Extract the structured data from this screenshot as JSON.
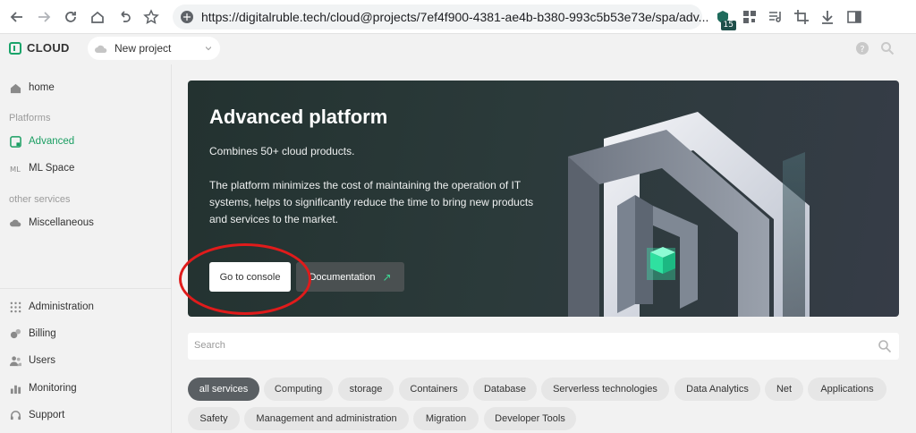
{
  "browser": {
    "url": "https://digitalruble.tech/cloud@projects/7ef4f900-4381-ae4b-b380-993c5b53e73e/spa/adv...",
    "extension_badge": "15"
  },
  "header": {
    "logo_text": "CLOUD",
    "project_name": "New project"
  },
  "sidebar": {
    "home": "home",
    "platforms_title": "Platforms",
    "advanced": "Advanced",
    "ml_space": "ML Space",
    "other_title": "other services",
    "misc": "Miscellaneous",
    "administration": "Administration",
    "billing": "Billing",
    "users": "Users",
    "monitoring": "Monitoring",
    "support": "Support"
  },
  "hero": {
    "title": "Advanced platform",
    "subtitle": "Combines 50+ cloud products.",
    "description": "The platform minimizes the cost of maintaining the operation of IT systems, helps to significantly reduce the time to bring new products and services to the market.",
    "console_button": "Go to console",
    "docs_button": "Documentation",
    "docs_arrow": "↗"
  },
  "search": {
    "placeholder": "Search"
  },
  "chips": [
    "all services",
    "Computing",
    "storage",
    "Containers",
    "Database",
    "Serverless technologies",
    "Data Analytics",
    "Net",
    "Applications",
    "Safety",
    "Management and administration",
    "Migration",
    "Developer Tools"
  ],
  "colors": {
    "accent": "#1a9e62",
    "annotation": "#e01b1b",
    "active_chip": "#5a5f63"
  }
}
